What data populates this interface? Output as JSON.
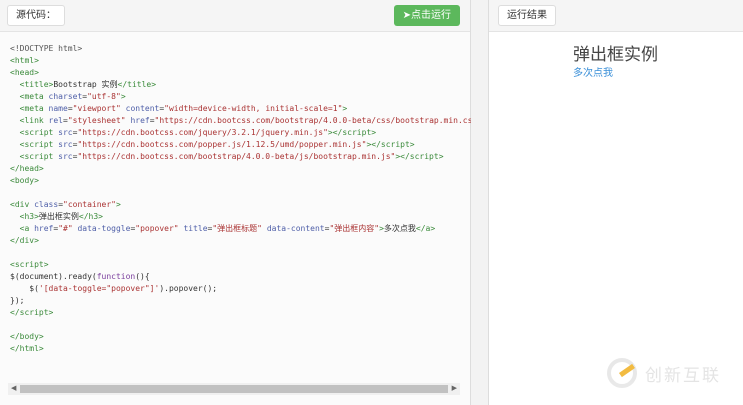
{
  "left": {
    "source_label": "源代码：",
    "run_label": "点击运行",
    "run_icon": "paper-plane-icon",
    "run_color": "#5cb85c"
  },
  "right": {
    "result_label": "运行结果",
    "heading": "弹出框实例",
    "link": "多次点我",
    "link_color": "#3a8fd8"
  },
  "watermark": "创新互联",
  "code": [
    [
      [
        "d",
        "<!DOCTYPE html>"
      ]
    ],
    [
      [
        "t",
        "<html>"
      ]
    ],
    [
      [
        "t",
        "<head>"
      ]
    ],
    [
      [
        "x",
        "  "
      ],
      [
        "t",
        "<title>"
      ],
      [
        "x",
        "Bootstrap 实例"
      ],
      [
        "t",
        "</title>"
      ]
    ],
    [
      [
        "x",
        "  "
      ],
      [
        "t",
        "<meta "
      ],
      [
        "a",
        "charset"
      ],
      [
        "x",
        "="
      ],
      [
        "s",
        "\"utf-8\""
      ],
      [
        "t",
        ">"
      ]
    ],
    [
      [
        "x",
        "  "
      ],
      [
        "t",
        "<meta "
      ],
      [
        "a",
        "name"
      ],
      [
        "x",
        "="
      ],
      [
        "s",
        "\"viewport\""
      ],
      [
        "a",
        " content"
      ],
      [
        "x",
        "="
      ],
      [
        "s",
        "\"width=device-width, initial-scale=1\""
      ],
      [
        "t",
        ">"
      ]
    ],
    [
      [
        "x",
        "  "
      ],
      [
        "t",
        "<link "
      ],
      [
        "a",
        "rel"
      ],
      [
        "x",
        "="
      ],
      [
        "s",
        "\"stylesheet\""
      ],
      [
        "a",
        " href"
      ],
      [
        "x",
        "="
      ],
      [
        "s",
        "\"https://cdn.bootcss.com/bootstrap/4.0.0-beta/css/bootstrap.min.css\""
      ]
    ],
    [
      [
        "x",
        "  "
      ],
      [
        "t",
        "<script "
      ],
      [
        "a",
        "src"
      ],
      [
        "x",
        "="
      ],
      [
        "s",
        "\"https://cdn.bootcss.com/jquery/3.2.1/jquery.min.js\""
      ],
      [
        "t",
        "></script>"
      ]
    ],
    [
      [
        "x",
        "  "
      ],
      [
        "t",
        "<script "
      ],
      [
        "a",
        "src"
      ],
      [
        "x",
        "="
      ],
      [
        "s",
        "\"https://cdn.bootcss.com/popper.js/1.12.5/umd/popper.min.js\""
      ],
      [
        "t",
        "></script>"
      ]
    ],
    [
      [
        "x",
        "  "
      ],
      [
        "t",
        "<script "
      ],
      [
        "a",
        "src"
      ],
      [
        "x",
        "="
      ],
      [
        "s",
        "\"https://cdn.bootcss.com/bootstrap/4.0.0-beta/js/bootstrap.min.js\""
      ],
      [
        "t",
        "></script>"
      ]
    ],
    [
      [
        "t",
        "</head>"
      ]
    ],
    [
      [
        "t",
        "<body>"
      ]
    ],
    [],
    [
      [
        "t",
        "<div "
      ],
      [
        "a",
        "class"
      ],
      [
        "x",
        "="
      ],
      [
        "s",
        "\"container\""
      ],
      [
        "t",
        ">"
      ]
    ],
    [
      [
        "x",
        "  "
      ],
      [
        "t",
        "<h3>"
      ],
      [
        "x",
        "弹出框实例"
      ],
      [
        "t",
        "</h3>"
      ]
    ],
    [
      [
        "x",
        "  "
      ],
      [
        "t",
        "<a "
      ],
      [
        "a",
        "href"
      ],
      [
        "x",
        "="
      ],
      [
        "s",
        "\"#\""
      ],
      [
        "a",
        " data-toggle"
      ],
      [
        "x",
        "="
      ],
      [
        "s",
        "\"popover\""
      ],
      [
        "a",
        " title"
      ],
      [
        "x",
        "="
      ],
      [
        "s",
        "\"弹出框标题\""
      ],
      [
        "a",
        " data-content"
      ],
      [
        "x",
        "="
      ],
      [
        "s",
        "\"弹出框内容\""
      ],
      [
        "t",
        ">"
      ],
      [
        "x",
        "多次点我"
      ],
      [
        "t",
        "</a>"
      ]
    ],
    [
      [
        "t",
        "</div>"
      ]
    ],
    [],
    [
      [
        "t",
        "<script>"
      ]
    ],
    [
      [
        "x",
        "$(document).ready("
      ],
      [
        "k",
        "function"
      ],
      [
        "x",
        "(){"
      ]
    ],
    [
      [
        "x",
        "    $("
      ],
      [
        "s",
        "'[data-toggle=\"popover\"]'"
      ],
      [
        "x",
        ").popover();"
      ]
    ],
    [
      [
        "x",
        "});"
      ]
    ],
    [
      [
        "t",
        "</script>"
      ]
    ],
    [],
    [
      [
        "t",
        "</body>"
      ]
    ],
    [
      [
        "t",
        "</html>"
      ]
    ]
  ]
}
